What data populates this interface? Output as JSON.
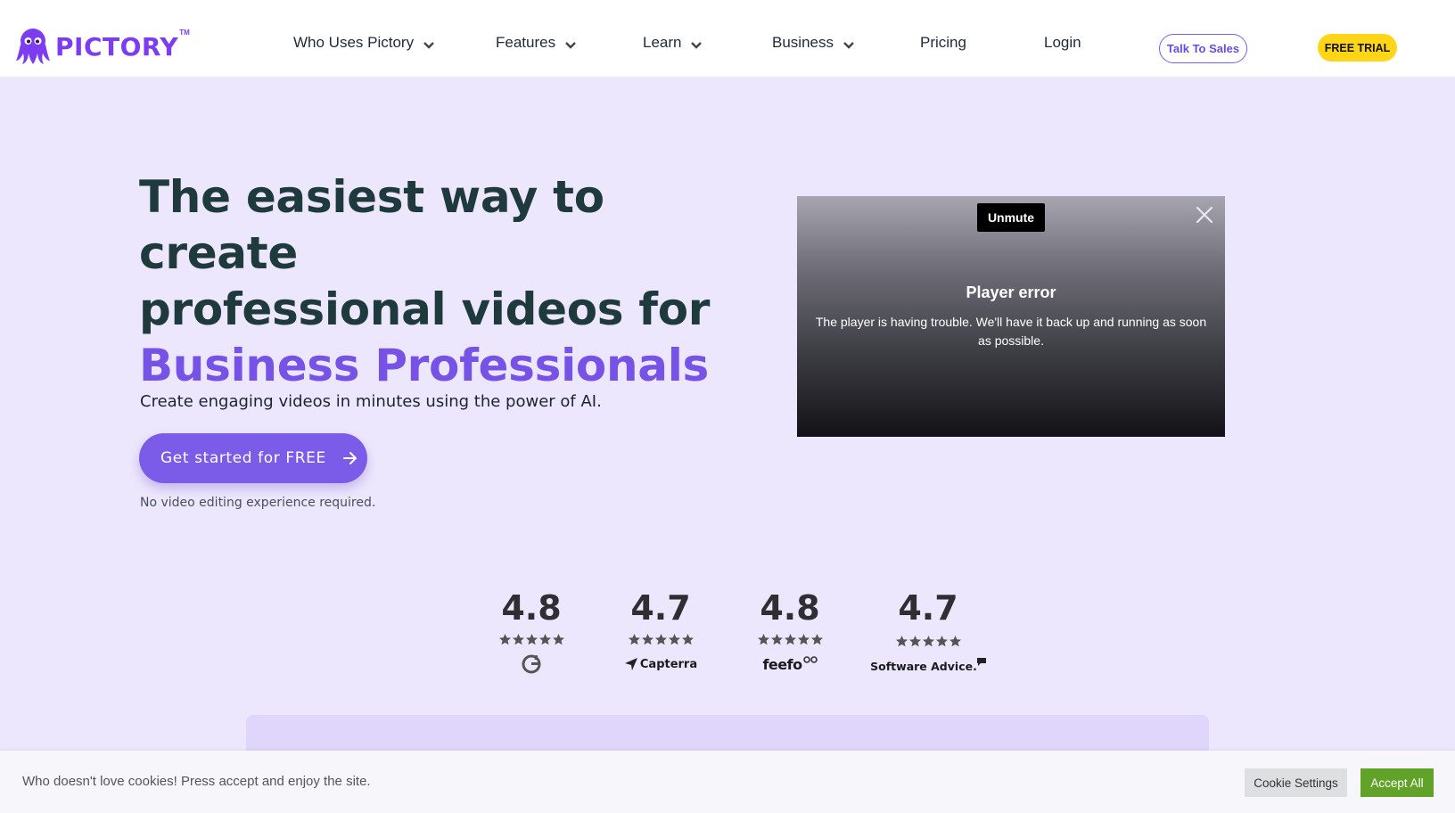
{
  "colors": {
    "brand": "#7d3cf0",
    "accent": "#7653e6",
    "cta": "#7b5ce9",
    "trial": "#ffd617",
    "accept": "#61a229",
    "hero_bg": "#ede7fd"
  },
  "header": {
    "logo_text": "PICTORY",
    "logo_tm": "TM",
    "nav": [
      {
        "label": "Who Uses Pictory",
        "has_dropdown": true,
        "icon": "chevron-down-icon"
      },
      {
        "label": "Features",
        "has_dropdown": true,
        "icon": "chevron-down-icon"
      },
      {
        "label": "Learn",
        "has_dropdown": true,
        "icon": "chevron-down-icon"
      },
      {
        "label": "Business",
        "has_dropdown": true,
        "icon": "chevron-down-icon"
      },
      {
        "label": "Pricing",
        "has_dropdown": false
      },
      {
        "label": "Login",
        "has_dropdown": false
      }
    ],
    "talk_to_sales": "Talk To Sales",
    "free_trial": "FREE TRIAL"
  },
  "hero": {
    "title_line1": "The easiest way to create",
    "title_line2": "professional videos for",
    "title_accent": "Business Professionals",
    "subtitle": "Create engaging videos in minutes using the power of AI.",
    "cta_label": "Get started for FREE",
    "cta_icon": "arrow-right-icon",
    "note": "No video editing experience required."
  },
  "video": {
    "unmute_label": "Unmute",
    "close_icon": "close-icon",
    "error_title": "Player error",
    "error_message": "The player is having trouble. We'll have it back up and running as soon as possible."
  },
  "ratings": [
    {
      "score": "4.8",
      "stars": 5,
      "source": "G2",
      "icon": "g2-logo-icon"
    },
    {
      "score": "4.7",
      "stars": 5,
      "source": "Capterra",
      "icon": "capterra-logo-icon"
    },
    {
      "score": "4.8",
      "stars": 5,
      "source": "feefo",
      "icon": "feefo-logo-icon"
    },
    {
      "score": "4.7",
      "stars": 5,
      "source": "Software Advice.",
      "icon": "software-advice-logo-icon"
    }
  ],
  "cookie": {
    "message": "Who doesn't love cookies! Press accept and enjoy the site.",
    "settings_label": "Cookie Settings",
    "accept_label": "Accept All"
  }
}
